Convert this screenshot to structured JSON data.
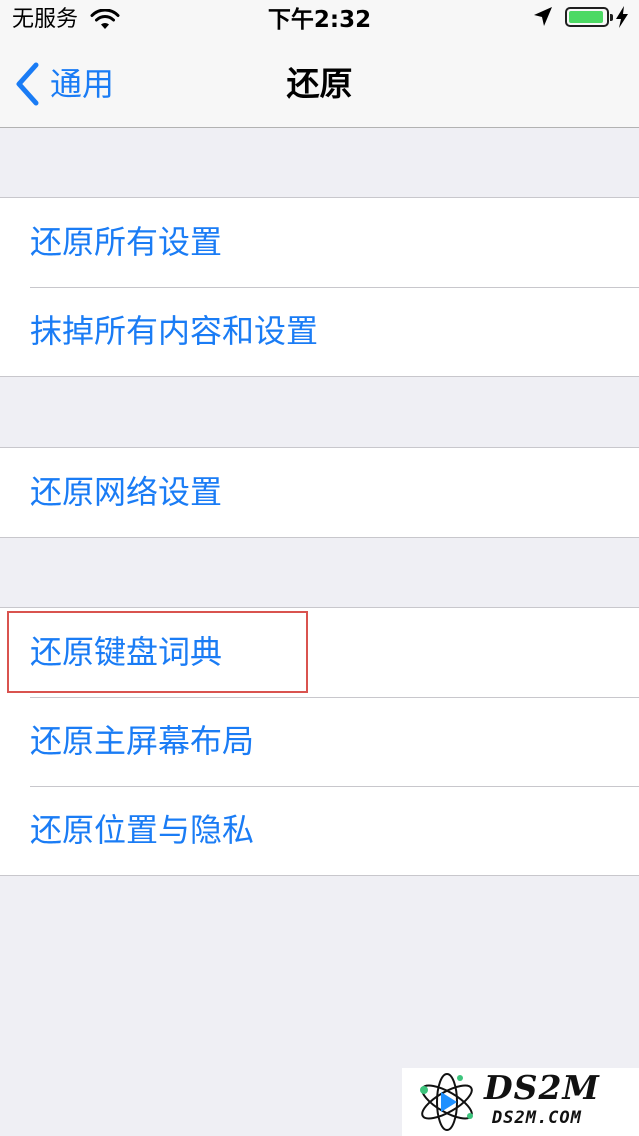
{
  "status_bar": {
    "carrier": "无服务",
    "time": "下午2:32",
    "battery_level": 0.95,
    "icons": [
      "wifi-icon",
      "location-arrow-icon",
      "battery-icon",
      "charging-bolt-icon"
    ]
  },
  "nav": {
    "back_label": "通用",
    "title": "还原",
    "back_icon": "chevron-left-icon"
  },
  "groups": [
    {
      "items": [
        "还原所有设置",
        "抹掉所有内容和设置"
      ]
    },
    {
      "items": [
        "还原网络设置"
      ]
    },
    {
      "items": [
        "还原键盘词典",
        "还原主屏幕布局",
        "还原位置与隐私"
      ]
    }
  ],
  "highlighted_item": "还原键盘词典",
  "watermark": {
    "brand": "DS2M",
    "domain": "DS2M.COM"
  },
  "colors": {
    "accent": "#1a7cf5",
    "background": "#efeff4",
    "cell": "#ffffff",
    "separator": "#c8c7cc",
    "highlight_border": "#d9534f",
    "battery": "#4cd964"
  }
}
